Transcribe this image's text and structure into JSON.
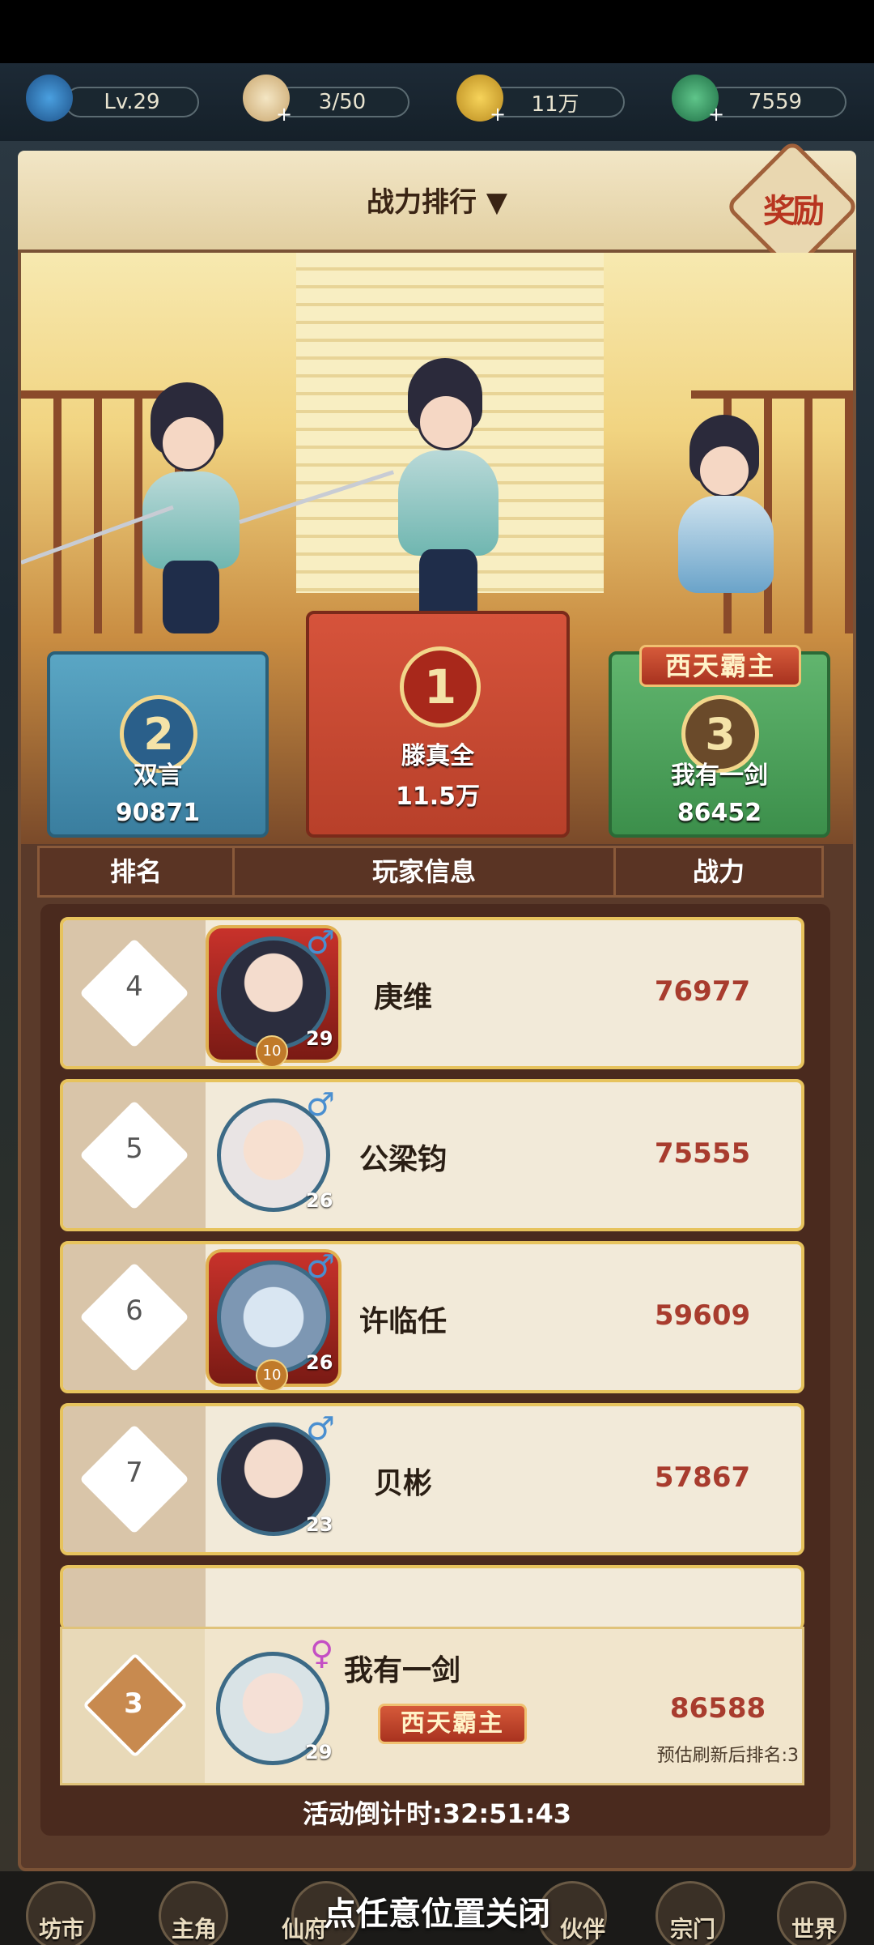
{
  "topbar": {
    "level": "Lv.29",
    "stamina": "3/50",
    "coins": "11万",
    "jade": "7559"
  },
  "header": {
    "title": "战力排行 ▼",
    "reward_label": "奖励"
  },
  "podium": [
    {
      "rank": "2",
      "name": "双言",
      "power": "90871"
    },
    {
      "rank": "1",
      "name": "滕真全",
      "power": "11.5万"
    },
    {
      "rank": "3",
      "name": "我有一剑",
      "power": "86452",
      "title": "西天霸主"
    }
  ],
  "table": {
    "col_rank": "排名",
    "col_info": "玩家信息",
    "col_power": "战力"
  },
  "rows": [
    {
      "rank": "4",
      "name": "庚维",
      "power": "76977",
      "level": "29",
      "vip": "10",
      "gender": "♂"
    },
    {
      "rank": "5",
      "name": "公梁钧",
      "power": "75555",
      "level": "26",
      "gender": "♂"
    },
    {
      "rank": "6",
      "name": "许临任",
      "power": "59609",
      "level": "26",
      "vip": "10",
      "gender": "♂"
    },
    {
      "rank": "7",
      "name": "贝彬",
      "power": "57867",
      "level": "23",
      "gender": "♂"
    }
  ],
  "me": {
    "rank": "3",
    "name": "我有一剑",
    "power": "86588",
    "level": "29",
    "gender": "♀",
    "title": "西天霸主",
    "estimate": "预估刷新后排名:3"
  },
  "countdown": "活动倒计时:32:51:43",
  "close_hint": "点任意位置关闭",
  "nav": [
    "坊市",
    "主角",
    "仙府",
    "伙伴",
    "宗门",
    "世界"
  ]
}
